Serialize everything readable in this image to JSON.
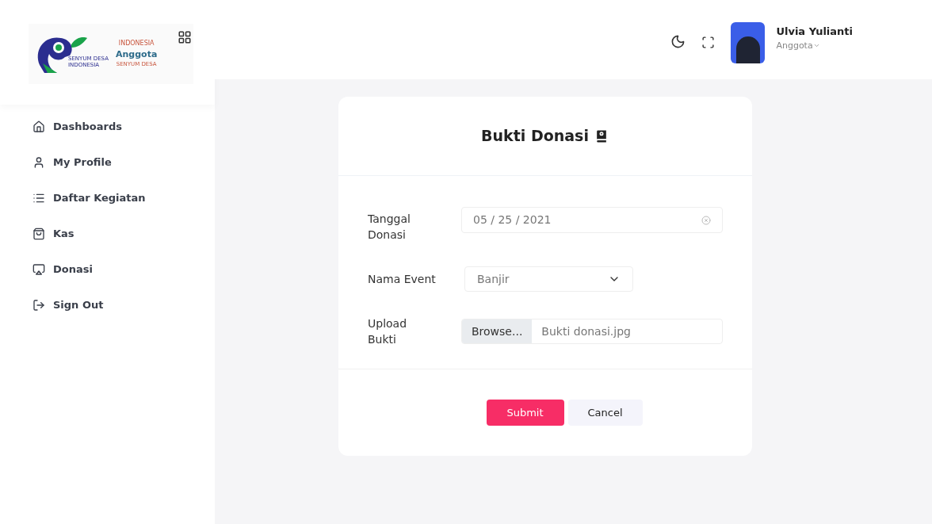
{
  "logo": {
    "caption": "SENYUM DESA INDONESIA",
    "line_1": "INDONESIA",
    "line_2": "Anggota",
    "line_3": "SENYUM DESA"
  },
  "sidebar": {
    "items": [
      {
        "kind": "home",
        "label": "Dashboards"
      },
      {
        "kind": "user",
        "label": "My Profile"
      },
      {
        "kind": "list",
        "label": "Daftar Kegiatan"
      },
      {
        "kind": "bag",
        "label": "Kas"
      },
      {
        "kind": "airplay",
        "label": "Donasi"
      },
      {
        "kind": "signout",
        "label": "Sign Out"
      }
    ]
  },
  "header": {
    "user_name": "Ulvia Yulianti",
    "user_role": "Anggota"
  },
  "card": {
    "title": "Bukti Donasi",
    "fields": [
      {
        "kind": "date",
        "label": "Tanggal Donasi",
        "value": "05 / 25 / 2021"
      },
      {
        "kind": "select",
        "label": "Nama Event",
        "value": "Banjir"
      },
      {
        "kind": "file",
        "label": "Upload Bukti",
        "button": "Browse...",
        "value": "Bukti donasi.jpg"
      }
    ],
    "buttons": [
      {
        "kind": "primary",
        "label": "Submit"
      },
      {
        "kind": "secondary",
        "label": "Cancel"
      }
    ]
  }
}
